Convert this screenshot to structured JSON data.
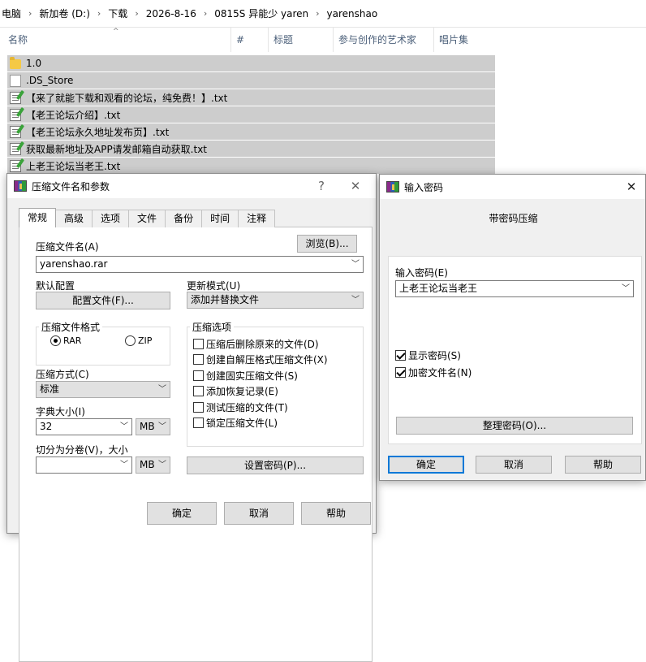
{
  "explorer": {
    "breadcrumb": [
      "电脑",
      "新加卷 (D:)",
      "下载",
      "2026-8-16",
      "0815S 异能少 yaren",
      "yarenshao"
    ],
    "crumb_separator": "›",
    "sort_indicator": "^",
    "columns": [
      "名称",
      "#",
      "标题",
      "参与创作的艺术家",
      "唱片集"
    ],
    "files": [
      {
        "name": "1.0",
        "icon": "folder-icon"
      },
      {
        "name": ".DS_Store",
        "icon": "file-icon"
      },
      {
        "name": "【来了就能下载和观看的论坛，纯免费！】.txt",
        "icon": "text-file-icon"
      },
      {
        "name": "【老王论坛介绍】.txt",
        "icon": "text-file-icon"
      },
      {
        "name": "【老王论坛永久地址发布页】.txt",
        "icon": "text-file-icon"
      },
      {
        "name": "获取最新地址及APP请发邮箱自动获取.txt",
        "icon": "text-file-icon"
      },
      {
        "name": "上老王论坛当老王.txt",
        "icon": "text-file-icon"
      }
    ]
  },
  "archive_dialog": {
    "title": "压缩文件名和参数",
    "help_glyph": "?",
    "close_glyph": "✕",
    "tabs": [
      "常规",
      "高级",
      "选项",
      "文件",
      "备份",
      "时间",
      "注释"
    ],
    "archive_name_label": "压缩文件名(A)",
    "browse_label": "浏览(B)...",
    "archive_name_value": "yarenshao.rar",
    "default_profile_label": "默认配置",
    "profiles_button": "配置文件(F)...",
    "update_mode_label": "更新模式(U)",
    "update_mode_value": "添加并替换文件",
    "format_group": "压缩文件格式",
    "format_rar": "RAR",
    "format_zip": "ZIP",
    "format_selected": "RAR",
    "options_group": "压缩选项",
    "options": [
      {
        "label": "压缩后删除原来的文件(D)",
        "checked": false
      },
      {
        "label": "创建自解压格式压缩文件(X)",
        "checked": false
      },
      {
        "label": "创建固实压缩文件(S)",
        "checked": false
      },
      {
        "label": "添加恢复记录(E)",
        "checked": false
      },
      {
        "label": "测试压缩的文件(T)",
        "checked": false
      },
      {
        "label": "锁定压缩文件(L)",
        "checked": false
      }
    ],
    "method_label": "压缩方式(C)",
    "method_value": "标准",
    "dict_label": "字典大小(I)",
    "dict_value": "32",
    "dict_unit": "MB",
    "split_label": "切分为分卷(V)，大小",
    "split_value": "",
    "split_unit": "MB",
    "set_password_button": "设置密码(P)...",
    "ok": "确定",
    "cancel": "取消",
    "help": "帮助"
  },
  "password_dialog": {
    "title": "输入密码",
    "close_glyph": "✕",
    "heading": "带密码压缩",
    "enter_label": "输入密码(E)",
    "password_value": "上老王论坛当老王",
    "show_password": "显示密码(S)",
    "show_password_checked": true,
    "encrypt_names": "加密文件名(N)",
    "encrypt_names_checked": true,
    "organize_button": "整理密码(O)...",
    "ok": "确定",
    "cancel": "取消",
    "help": "帮助"
  }
}
